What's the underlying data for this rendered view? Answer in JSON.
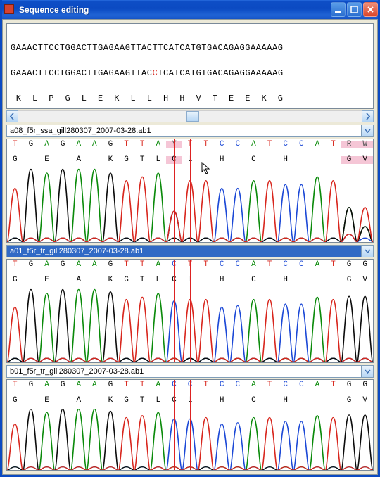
{
  "window": {
    "title": "Sequence editing"
  },
  "alignment": {
    "row1": "GAAACTTCCTGGACTTGAGAAGTTACTTCATCATGTGACAGAGGAAAAAG",
    "row2": "GAAACTTCCTGGACTTGAGAAGTTACCTCATCATGTGACAGAGGAAAAAG",
    "row2_diff": [
      26
    ],
    "row3": " K  L  P  G  L  E  K  L  L  H  H  V  T  E  E  K  G"
  },
  "files": [
    {
      "label": "a08_f5r_ssa_gill280307_2007-03-28.ab1",
      "selected": false
    },
    {
      "label": "a01_f5r_tr_gill280307_2007-03-28.ab1",
      "selected": true
    },
    {
      "label": "b01_f5r_tr_gill280307_2007-03-28.ab1",
      "selected": false
    }
  ],
  "panel_bases": {
    "p0": {
      "calls": "TGAGAAGTTAYTTCCATCCATRW",
      "trans": "GEAKGTLCLHCHGV",
      "trans_pos": [
        0,
        2,
        4,
        6,
        7,
        8,
        9,
        10,
        11,
        13,
        15,
        17,
        21,
        22
      ],
      "highlights": [
        10,
        21,
        22
      ]
    },
    "p1": {
      "calls": "TGAGAAGTTACTTCCATCCATGG",
      "trans": "GEAKGTLCLHCHGV",
      "trans_pos": [
        0,
        2,
        4,
        6,
        7,
        8,
        9,
        10,
        11,
        13,
        15,
        17,
        21,
        22
      ]
    },
    "p2": {
      "calls": "TGAGAAGTTACCTCCATCCATGG",
      "trans": "GEAKGTLCLHCHGV",
      "trans_pos": [
        0,
        2,
        4,
        6,
        7,
        8,
        9,
        10,
        11,
        13,
        15,
        17,
        21,
        22
      ]
    }
  },
  "chart_data": [
    {
      "type": "line",
      "title": "a08_f5r_ssa chromatogram",
      "xlabel": "",
      "ylabel": "",
      "x": [
        0,
        1,
        2,
        3,
        4,
        5,
        6,
        7,
        8,
        9,
        10,
        11,
        12,
        13,
        14,
        15,
        16,
        17,
        18,
        19,
        20,
        21,
        22
      ],
      "series": [
        {
          "name": "A",
          "color": "#0a8a0a",
          "values": [
            5,
            5,
            90,
            5,
            95,
            95,
            5,
            5,
            5,
            90,
            40,
            5,
            5,
            5,
            5,
            80,
            5,
            5,
            5,
            85,
            5,
            45,
            20
          ]
        },
        {
          "name": "C",
          "color": "#1b48d6",
          "values": [
            5,
            5,
            5,
            5,
            5,
            5,
            5,
            5,
            5,
            5,
            40,
            5,
            5,
            70,
            70,
            5,
            5,
            75,
            75,
            5,
            5,
            10,
            5
          ]
        },
        {
          "name": "G",
          "color": "#0b0b0b",
          "values": [
            5,
            95,
            5,
            95,
            5,
            5,
            90,
            5,
            5,
            5,
            5,
            5,
            5,
            5,
            5,
            5,
            5,
            5,
            5,
            5,
            5,
            45,
            20
          ]
        },
        {
          "name": "T",
          "color": "#d8261d",
          "values": [
            70,
            5,
            5,
            5,
            5,
            5,
            5,
            80,
            85,
            5,
            40,
            80,
            80,
            5,
            5,
            5,
            80,
            5,
            5,
            5,
            80,
            10,
            45
          ]
        }
      ],
      "ylim": [
        0,
        100
      ]
    },
    {
      "type": "line",
      "title": "a01_f5r_tr chromatogram",
      "xlabel": "",
      "ylabel": "",
      "x": [
        0,
        1,
        2,
        3,
        4,
        5,
        6,
        7,
        8,
        9,
        10,
        11,
        12,
        13,
        14,
        15,
        16,
        17,
        18,
        19,
        20,
        21,
        22
      ],
      "series": [
        {
          "name": "A",
          "color": "#0a8a0a",
          "values": [
            5,
            5,
            90,
            5,
            95,
            95,
            5,
            5,
            5,
            90,
            5,
            5,
            5,
            5,
            5,
            82,
            5,
            5,
            5,
            85,
            5,
            5,
            5
          ]
        },
        {
          "name": "C",
          "color": "#1b48d6",
          "values": [
            5,
            5,
            5,
            5,
            5,
            5,
            5,
            5,
            5,
            5,
            80,
            5,
            5,
            72,
            74,
            5,
            5,
            76,
            76,
            5,
            5,
            5,
            5
          ]
        },
        {
          "name": "G",
          "color": "#0b0b0b",
          "values": [
            5,
            95,
            5,
            95,
            5,
            5,
            92,
            5,
            5,
            5,
            5,
            5,
            5,
            5,
            5,
            5,
            5,
            5,
            5,
            5,
            5,
            86,
            86
          ]
        },
        {
          "name": "T",
          "color": "#d8261d",
          "values": [
            72,
            5,
            5,
            5,
            5,
            5,
            5,
            82,
            85,
            5,
            5,
            82,
            82,
            5,
            5,
            5,
            82,
            5,
            5,
            5,
            82,
            5,
            5
          ]
        }
      ],
      "ylim": [
        0,
        100
      ]
    },
    {
      "type": "line",
      "title": "b01_f5r_tr chromatogram",
      "xlabel": "",
      "ylabel": "",
      "x": [
        0,
        1,
        2,
        3,
        4,
        5,
        6,
        7,
        8,
        9,
        10,
        11,
        12,
        13,
        14,
        15,
        16,
        17,
        18,
        19,
        20,
        21,
        22
      ],
      "series": [
        {
          "name": "A",
          "color": "#0a8a0a",
          "values": [
            5,
            5,
            90,
            5,
            95,
            95,
            5,
            5,
            5,
            90,
            5,
            5,
            5,
            5,
            5,
            82,
            5,
            5,
            5,
            85,
            5,
            5,
            5
          ]
        },
        {
          "name": "C",
          "color": "#1b48d6",
          "values": [
            5,
            5,
            5,
            5,
            5,
            5,
            5,
            5,
            5,
            5,
            80,
            80,
            5,
            72,
            74,
            5,
            5,
            76,
            76,
            5,
            5,
            5,
            5
          ]
        },
        {
          "name": "G",
          "color": "#0b0b0b",
          "values": [
            5,
            95,
            5,
            95,
            5,
            5,
            92,
            5,
            5,
            5,
            5,
            5,
            5,
            5,
            5,
            5,
            5,
            5,
            5,
            5,
            5,
            86,
            86
          ]
        },
        {
          "name": "T",
          "color": "#d8261d",
          "values": [
            72,
            5,
            5,
            5,
            5,
            5,
            5,
            82,
            85,
            5,
            5,
            5,
            82,
            5,
            5,
            5,
            82,
            5,
            5,
            5,
            82,
            5,
            5
          ]
        }
      ],
      "ylim": [
        0,
        100
      ]
    }
  ],
  "cursor_lines": {
    "center_index": 10.5,
    "left_index": 10,
    "right_index": 11
  }
}
